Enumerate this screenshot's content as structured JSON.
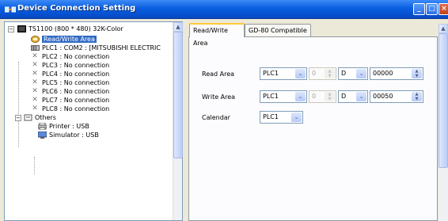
{
  "window": {
    "title": "Device Connection Setting",
    "min_glyph": "_",
    "max_glyph": "□",
    "close_glyph": "×"
  },
  "tree": {
    "root": "TS1100 (800 * 480) 32K-Color",
    "items": [
      {
        "label": "Read/Write Area",
        "icon": "read-write-area-icon",
        "selected": true
      },
      {
        "label": "PLC1 : COM2 : [MITSUBISHI ELECTRIC",
        "icon": "plc-device-icon"
      },
      {
        "label": "PLC2 : No connection",
        "icon": "no-connection-icon"
      },
      {
        "label": "PLC3 : No connection",
        "icon": "no-connection-icon"
      },
      {
        "label": "PLC4 : No connection",
        "icon": "no-connection-icon"
      },
      {
        "label": "PLC5 : No connection",
        "icon": "no-connection-icon"
      },
      {
        "label": "PLC6 : No connection",
        "icon": "no-connection-icon"
      },
      {
        "label": "PLC7 : No connection",
        "icon": "no-connection-icon"
      },
      {
        "label": "PLC8 : No connection",
        "icon": "no-connection-icon"
      }
    ],
    "others": {
      "label": "Others",
      "children": [
        {
          "label": "Printer : USB",
          "icon": "printer-icon"
        },
        {
          "label": "Simulator : USB",
          "icon": "simulator-icon"
        }
      ]
    },
    "collapse_glyph": "−"
  },
  "tabs": [
    {
      "label": "Read/Write Area",
      "active": true
    },
    {
      "label": "GD-80 Compatible",
      "active": false
    }
  ],
  "fields": {
    "read_area": {
      "label": "Read Area",
      "plc": "PLC1",
      "port": "0",
      "device": "D",
      "address": "00000"
    },
    "write_area": {
      "label": "Write Area",
      "plc": "PLC1",
      "port": "0",
      "device": "D",
      "address": "00050"
    },
    "calendar": {
      "label": "Calendar",
      "plc": "PLC1"
    }
  },
  "colors": {
    "titlebar": "#0a5fe0",
    "selection": "#316ac5",
    "tab_highlight": "#ffc83c"
  }
}
